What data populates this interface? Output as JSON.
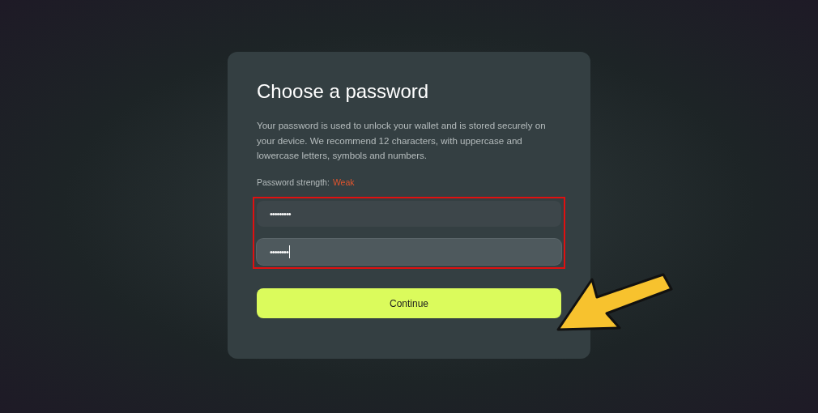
{
  "title": "Choose a password",
  "description": "Your password is used to unlock your wallet and is stored securely on your device. We recommend 12 characters, with uppercase and lowercase letters, symbols and numbers.",
  "strength": {
    "label": "Password strength:",
    "value": "Weak"
  },
  "fields": [
    {
      "value": "•••••••••",
      "focused": false
    },
    {
      "value": "••••••••",
      "focused": true
    }
  ],
  "continue_button": "Continue"
}
